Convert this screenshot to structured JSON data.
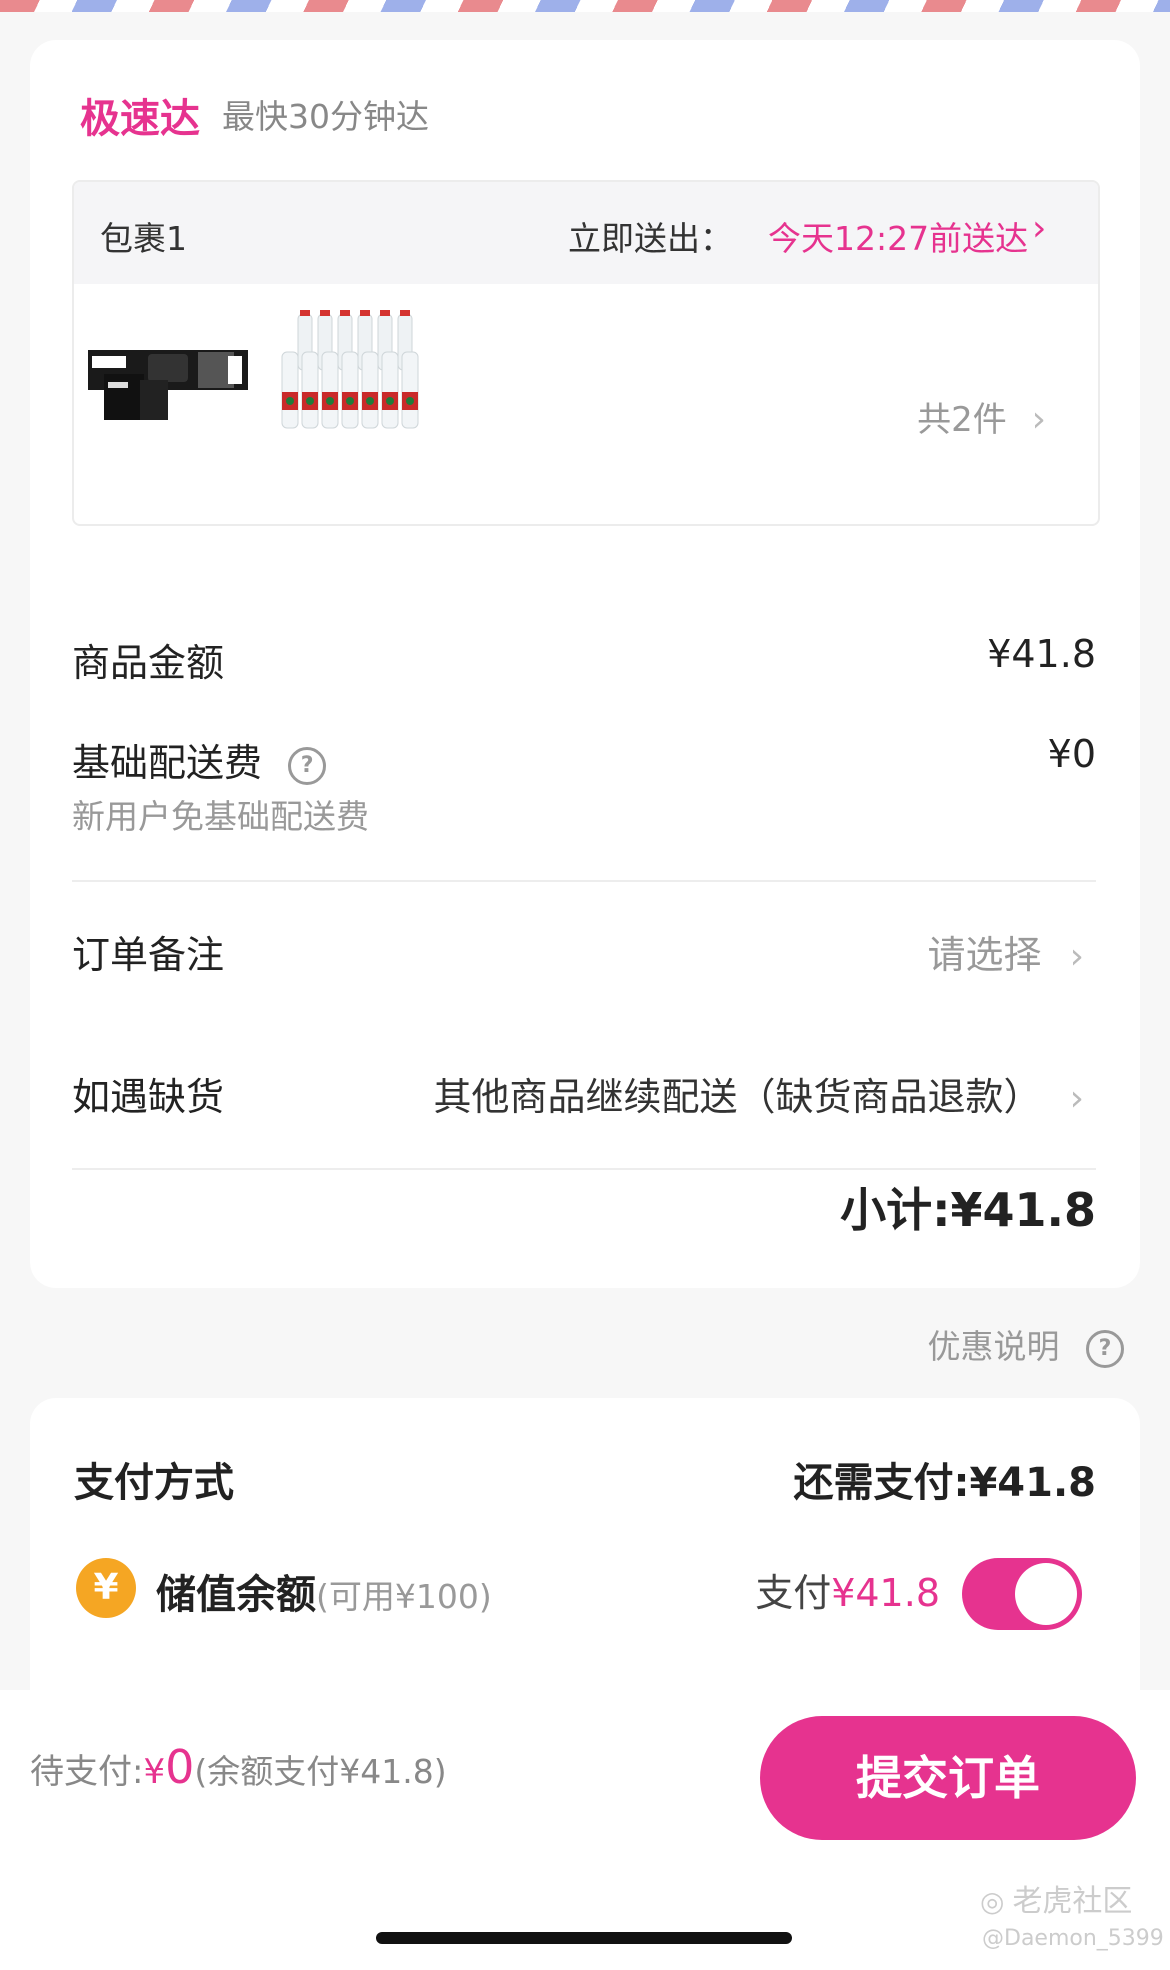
{
  "express": {
    "title": "极速达",
    "subtitle": "最快30分钟达"
  },
  "package": {
    "label": "包裹1",
    "dispatch_label": "立即送出：",
    "dispatch_time": "今天12:27前送达",
    "count": "共2件",
    "products": [
      "tissue-pack-image",
      "water-bottles-image"
    ]
  },
  "summary": {
    "goods_label": "商品金额",
    "goods_value": "¥41.8",
    "delivery_label": "基础配送费",
    "delivery_value": "¥0",
    "delivery_note": "新用户免基础配送费"
  },
  "remark": {
    "label": "订单备注",
    "value": "请选择"
  },
  "stockout": {
    "label": "如遇缺货",
    "value": "其他商品继续配送（缺货商品退款）"
  },
  "subtotal": "小计:¥41.8",
  "promo_note": "优惠说明",
  "payment": {
    "title": "支付方式",
    "remaining": "还需支付:¥41.8",
    "balance_label": "储值余额",
    "balance_available": "(可用¥100)",
    "pay_prefix": "支付",
    "pay_amount": "¥41.8",
    "toggle_on": true
  },
  "bottom": {
    "pending_label": "待支付:",
    "pending_currency": "¥",
    "pending_amount": "0",
    "balance_note": "(余额支付¥41.8)",
    "submit_label": "提交订单"
  },
  "watermark": {
    "brand": "老虎社区",
    "user": "@Daemon_5399"
  },
  "colors": {
    "accent": "#e6338f",
    "coin": "#f5a623"
  }
}
